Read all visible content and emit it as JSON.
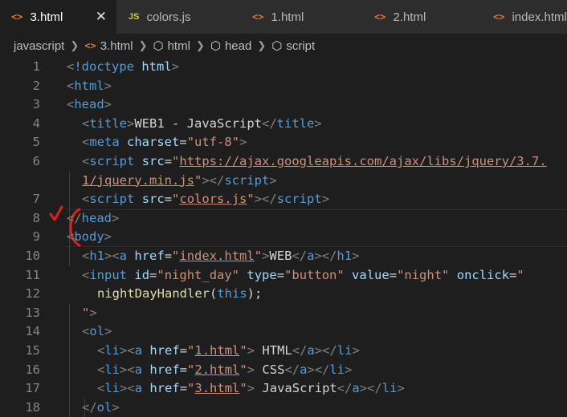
{
  "tabs": [
    {
      "icon": "<>",
      "type": "html",
      "label": "3.html",
      "close": "✕"
    },
    {
      "icon": "JS",
      "type": "js",
      "label": "colors.js"
    },
    {
      "icon": "<>",
      "type": "html",
      "label": "1.html"
    },
    {
      "icon": "<>",
      "type": "html",
      "label": "2.html"
    },
    {
      "icon": "<>",
      "type": "html",
      "label": "index.html"
    }
  ],
  "breadcrumb": [
    {
      "label": "javascript",
      "icon": "folder"
    },
    {
      "label": "3.html",
      "icon": "html-file-icon",
      "glyph": "<>"
    },
    {
      "label": "html",
      "icon": "cube-icon",
      "glyph": "⬡"
    },
    {
      "label": "head",
      "icon": "cube-icon",
      "glyph": "⬡"
    },
    {
      "label": "script",
      "icon": "cube-icon",
      "glyph": "⬡"
    }
  ],
  "colors": {
    "accent_orange": "#e37933",
    "js_yellow": "#cbcb41",
    "annotation_red": "#e0201f",
    "background": "#1e1e1e"
  },
  "lines": [
    {
      "num": "1",
      "indent": 0,
      "tokens": [
        [
          "tg",
          "<"
        ],
        [
          "tn",
          "!doctype"
        ],
        [
          "tx",
          " "
        ],
        [
          "at",
          "html"
        ],
        [
          "tg",
          ">"
        ]
      ]
    },
    {
      "num": "2",
      "indent": 0,
      "tokens": [
        [
          "tg",
          "<"
        ],
        [
          "tn",
          "html"
        ],
        [
          "tg",
          ">"
        ]
      ]
    },
    {
      "num": "3",
      "indent": 0,
      "tokens": [
        [
          "tg",
          "<"
        ],
        [
          "tn",
          "head"
        ],
        [
          "tg",
          ">"
        ]
      ]
    },
    {
      "num": "4",
      "indent": 1,
      "tokens": [
        [
          "tg",
          "<"
        ],
        [
          "tn",
          "title"
        ],
        [
          "tg",
          ">"
        ],
        [
          "tx",
          "WEB1 - JavaScript"
        ],
        [
          "tg",
          "</"
        ],
        [
          "tn",
          "title"
        ],
        [
          "tg",
          ">"
        ]
      ]
    },
    {
      "num": "5",
      "indent": 1,
      "tokens": [
        [
          "tg",
          "<"
        ],
        [
          "tn",
          "meta"
        ],
        [
          "tx",
          " "
        ],
        [
          "at",
          "charset"
        ],
        [
          "tx",
          "="
        ],
        [
          "st",
          "\"utf-8\""
        ],
        [
          "tg",
          ">"
        ]
      ]
    },
    {
      "num": "6",
      "indent": 1,
      "tokens": [
        [
          "tg",
          "<"
        ],
        [
          "tn",
          "script"
        ],
        [
          "tx",
          " "
        ],
        [
          "at",
          "src"
        ],
        [
          "tx",
          "="
        ],
        [
          "st",
          "\""
        ],
        [
          "st ul",
          "https://ajax.googleapis.com/ajax/libs/jquery/3.7."
        ]
      ]
    },
    {
      "num": "",
      "indent": 1,
      "tokens": [
        [
          "st ul",
          "1/jquery.min.js"
        ],
        [
          "st",
          "\""
        ],
        [
          "tg",
          "></"
        ],
        [
          "tn",
          "script"
        ],
        [
          "tg",
          ">"
        ]
      ]
    },
    {
      "num": "7",
      "indent": 1,
      "tokens": [
        [
          "tg",
          "<"
        ],
        [
          "tn",
          "script"
        ],
        [
          "tx",
          " "
        ],
        [
          "at",
          "src"
        ],
        [
          "tx",
          "="
        ],
        [
          "st",
          "\""
        ],
        [
          "st ul",
          "colors.js"
        ],
        [
          "st",
          "\""
        ],
        [
          "tg",
          "></"
        ],
        [
          "tn",
          "script"
        ],
        [
          "tg",
          ">"
        ]
      ]
    },
    {
      "num": "8",
      "indent": 0,
      "tokens": [
        [
          "tg",
          "</"
        ],
        [
          "tn",
          "head"
        ],
        [
          "tg",
          ">"
        ]
      ]
    },
    {
      "num": "9",
      "indent": 0,
      "tokens": [
        [
          "tg",
          "<"
        ],
        [
          "tn",
          "body"
        ],
        [
          "tg",
          ">"
        ]
      ]
    },
    {
      "num": "10",
      "indent": 1,
      "tokens": [
        [
          "tg",
          "<"
        ],
        [
          "tn",
          "h1"
        ],
        [
          "tg",
          "><"
        ],
        [
          "tn",
          "a"
        ],
        [
          "tx",
          " "
        ],
        [
          "at",
          "href"
        ],
        [
          "tx",
          "="
        ],
        [
          "st",
          "\""
        ],
        [
          "st ul",
          "index.html"
        ],
        [
          "st",
          "\""
        ],
        [
          "tg",
          ">"
        ],
        [
          "tx",
          "WEB"
        ],
        [
          "tg",
          "</"
        ],
        [
          "tn",
          "a"
        ],
        [
          "tg",
          "></"
        ],
        [
          "tn",
          "h1"
        ],
        [
          "tg",
          ">"
        ]
      ]
    },
    {
      "num": "11",
      "indent": 1,
      "tokens": [
        [
          "tg",
          "<"
        ],
        [
          "tn",
          "input"
        ],
        [
          "tx",
          " "
        ],
        [
          "at",
          "id"
        ],
        [
          "tx",
          "="
        ],
        [
          "st",
          "\"night_day\""
        ],
        [
          "tx",
          " "
        ],
        [
          "at",
          "type"
        ],
        [
          "tx",
          "="
        ],
        [
          "st",
          "\"button\""
        ],
        [
          "tx",
          " "
        ],
        [
          "at",
          "value"
        ],
        [
          "tx",
          "="
        ],
        [
          "st",
          "\"night\""
        ],
        [
          "tx",
          " "
        ],
        [
          "at",
          "onclick"
        ],
        [
          "tx",
          "="
        ],
        [
          "st",
          "\""
        ]
      ]
    },
    {
      "num": "12",
      "indent": 2,
      "tokens": [
        [
          "fn",
          "nightDayHandler"
        ],
        [
          "tx",
          "("
        ],
        [
          "kw",
          "this"
        ],
        [
          "tx",
          ");"
        ]
      ]
    },
    {
      "num": "13",
      "indent": 1,
      "tokens": [
        [
          "st",
          "\""
        ],
        [
          "tg",
          ">"
        ]
      ]
    },
    {
      "num": "14",
      "indent": 1,
      "tokens": [
        [
          "tg",
          "<"
        ],
        [
          "tn",
          "ol"
        ],
        [
          "tg",
          ">"
        ]
      ]
    },
    {
      "num": "15",
      "indent": 2,
      "tokens": [
        [
          "tg",
          "<"
        ],
        [
          "tn",
          "li"
        ],
        [
          "tg",
          "><"
        ],
        [
          "tn",
          "a"
        ],
        [
          "tx",
          " "
        ],
        [
          "at",
          "href"
        ],
        [
          "tx",
          "="
        ],
        [
          "st",
          "\""
        ],
        [
          "st ul",
          "1.html"
        ],
        [
          "st",
          "\""
        ],
        [
          "tg",
          ">"
        ],
        [
          "tx",
          " HTML"
        ],
        [
          "tg",
          "</"
        ],
        [
          "tn",
          "a"
        ],
        [
          "tg",
          "></"
        ],
        [
          "tn",
          "li"
        ],
        [
          "tg",
          ">"
        ]
      ]
    },
    {
      "num": "16",
      "indent": 2,
      "tokens": [
        [
          "tg",
          "<"
        ],
        [
          "tn",
          "li"
        ],
        [
          "tg",
          "><"
        ],
        [
          "tn",
          "a"
        ],
        [
          "tx",
          " "
        ],
        [
          "at",
          "href"
        ],
        [
          "tx",
          "="
        ],
        [
          "st",
          "\""
        ],
        [
          "st ul",
          "2.html"
        ],
        [
          "st",
          "\""
        ],
        [
          "tg",
          ">"
        ],
        [
          "tx",
          " CSS"
        ],
        [
          "tg",
          "</"
        ],
        [
          "tn",
          "a"
        ],
        [
          "tg",
          "></"
        ],
        [
          "tn",
          "li"
        ],
        [
          "tg",
          ">"
        ]
      ]
    },
    {
      "num": "17",
      "indent": 2,
      "tokens": [
        [
          "tg",
          "<"
        ],
        [
          "tn",
          "li"
        ],
        [
          "tg",
          "><"
        ],
        [
          "tn",
          "a"
        ],
        [
          "tx",
          " "
        ],
        [
          "at",
          "href"
        ],
        [
          "tx",
          "="
        ],
        [
          "st",
          "\""
        ],
        [
          "st ul",
          "3.html"
        ],
        [
          "st",
          "\""
        ],
        [
          "tg",
          ">"
        ],
        [
          "tx",
          " JavaScript"
        ],
        [
          "tg",
          "</"
        ],
        [
          "tn",
          "a"
        ],
        [
          "tg",
          "></"
        ],
        [
          "tn",
          "li"
        ],
        [
          "tg",
          ">"
        ]
      ]
    },
    {
      "num": "18",
      "indent": 1,
      "tokens": [
        [
          "tg",
          "</"
        ],
        [
          "tn",
          "ol"
        ],
        [
          "tg",
          ">"
        ]
      ]
    }
  ]
}
